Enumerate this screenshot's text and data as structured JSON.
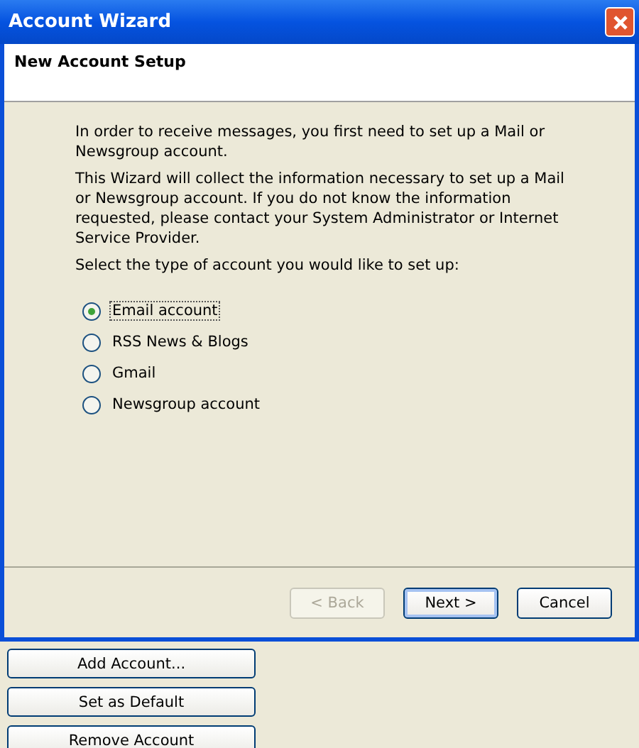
{
  "window": {
    "title": "Account Wizard"
  },
  "header": {
    "title": "New Account Setup"
  },
  "intro": [
    "In order to receive messages, you first need to set up a Mail or Newsgroup account.",
    "This Wizard will collect the information necessary to set up a Mail or Newsgroup account. If you do not know the information requested, please contact your System Administrator or Internet Service Provider.",
    "Select the type of account you would like to set up:"
  ],
  "account_types": [
    {
      "label": "Email account",
      "selected": true
    },
    {
      "label": "RSS News & Blogs",
      "selected": false
    },
    {
      "label": "Gmail",
      "selected": false
    },
    {
      "label": "Newsgroup account",
      "selected": false
    }
  ],
  "wizard_buttons": [
    {
      "label": "< Back",
      "disabled": true,
      "default": false
    },
    {
      "label": "Next >",
      "disabled": false,
      "default": true
    },
    {
      "label": "Cancel",
      "disabled": false,
      "default": false
    }
  ],
  "background_buttons": [
    "Add Account...",
    "Set as Default",
    "Remove Account"
  ]
}
